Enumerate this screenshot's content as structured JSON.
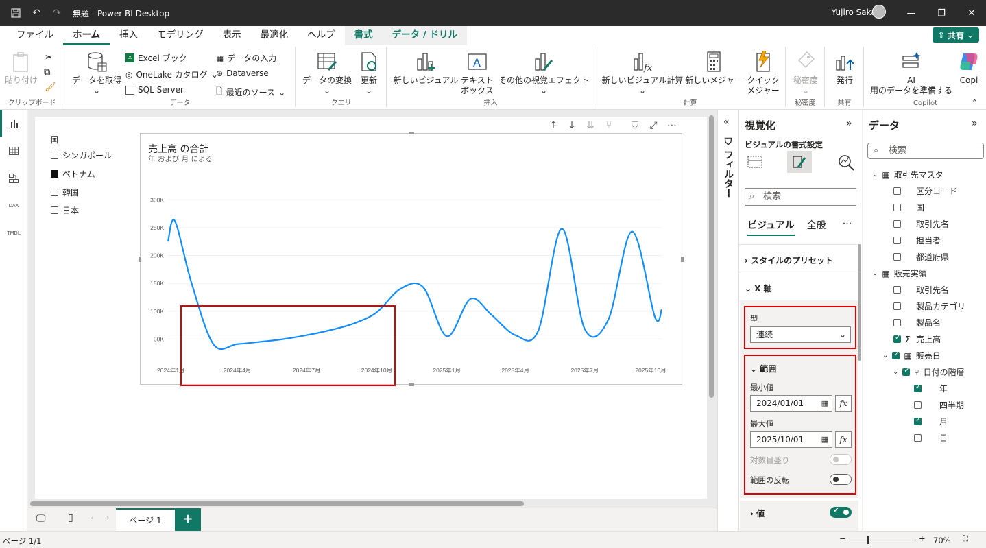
{
  "titlebar": {
    "title": "無題 - Power BI Desktop",
    "user": "Yujiro Sakaki"
  },
  "tabs": [
    "ファイル",
    "ホーム",
    "挿入",
    "モデリング",
    "表示",
    "最適化",
    "ヘルプ",
    "書式",
    "データ / ドリル"
  ],
  "share_label": "共有",
  "ribbon": {
    "clipboard": {
      "paste": "貼り付け",
      "group": "クリップボード"
    },
    "data": {
      "get_data": "データを取得",
      "excel": "Excel ブック",
      "onelake": "OneLake カタログ",
      "sql": "SQL Server",
      "enter": "データの入力",
      "dataverse": "Dataverse",
      "recent": "最近のソース",
      "group": "データ"
    },
    "query": {
      "transform": "データの変換",
      "refresh": "更新",
      "group": "クエリ"
    },
    "insert": {
      "new_visual": "新しいビジュアル",
      "textbox_1": "テキスト",
      "textbox_2": "ボックス",
      "more_visuals": "その他の視覚エフェクト",
      "group": "挿入"
    },
    "calc": {
      "visual_calc": "新しいビジュアル計算",
      "new_measure": "新しいメジャー",
      "quick_1": "クイック",
      "quick_2": "メジャー",
      "group": "計算"
    },
    "sensitivity": {
      "label": "秘密度",
      "group": "秘密度"
    },
    "share": {
      "publish": "発行",
      "group": "共有"
    },
    "copilot": {
      "ai_1": "AI",
      "ai_2": "用のデータを準備する",
      "copilot": "Copi",
      "group": "Copilot"
    }
  },
  "slicer": {
    "title": "国",
    "items": [
      "シンガポール",
      "ベトナム",
      "韓国",
      "日本"
    ],
    "selected_index": 1
  },
  "visual": {
    "title": "売上高 の合計",
    "subtitle": "年 および 月 による"
  },
  "chart_data": {
    "type": "line",
    "title": "売上高 の合計",
    "subtitle": "年 および 月 による",
    "x_ticks": [
      "2024年1月",
      "2024年4月",
      "2024年7月",
      "2024年10月",
      "2025年1月",
      "2025年4月",
      "2025年7月",
      "2025年10月"
    ],
    "y_ticks": [
      "300K",
      "250K",
      "200K",
      "150K",
      "100K",
      "50K"
    ],
    "ylim": [
      0,
      320000
    ],
    "series": [
      {
        "color": "#118DFF",
        "points": [
          [
            "2024-01-01",
            225000
          ],
          [
            "2024-01-10",
            262000
          ],
          [
            "2024-02-01",
            150000
          ],
          [
            "2024-03-01",
            40000
          ],
          [
            "2024-04-01",
            41000
          ],
          [
            "2024-05-01",
            45000
          ],
          [
            "2024-06-01",
            50000
          ],
          [
            "2024-07-01",
            57000
          ],
          [
            "2024-08-01",
            66000
          ],
          [
            "2024-09-01",
            78000
          ],
          [
            "2024-10-01",
            98000
          ],
          [
            "2024-11-01",
            140000
          ],
          [
            "2024-12-01",
            143000
          ],
          [
            "2025-01-01",
            55000
          ],
          [
            "2025-02-01",
            122000
          ],
          [
            "2025-03-01",
            93000
          ],
          [
            "2025-04-01",
            57000
          ],
          [
            "2025-05-01",
            65000
          ],
          [
            "2025-06-01",
            248000
          ],
          [
            "2025-07-01",
            68000
          ],
          [
            "2025-08-01",
            85000
          ],
          [
            "2025-09-01",
            243000
          ],
          [
            "2025-10-01",
            90000
          ],
          [
            "2025-10-10",
            103000
          ]
        ]
      }
    ],
    "x_range": [
      "2024-01-01",
      "2025-10-10"
    ],
    "grid": true
  },
  "filter_pane": {
    "label": "フィルター"
  },
  "viz_pane": {
    "title": "視覚化",
    "subtitle": "ビジュアルの書式設定",
    "search_placeholder": "検索",
    "tab_visual": "ビジュアル",
    "tab_general": "全般",
    "style_presets": "スタイルのプリセット",
    "x_axis": "X 軸",
    "type_label": "型",
    "type_value": "連続",
    "range": "範囲",
    "min_label": "最小値",
    "min_value": "2024/01/01",
    "max_label": "最大値",
    "max_value": "2025/10/01",
    "log_scale": "対数目盛り",
    "invert_range": "範囲の反転",
    "values": "値"
  },
  "data_pane": {
    "title": "データ",
    "search_placeholder": "検索",
    "tables": [
      {
        "name": "取引先マスタ",
        "fields": [
          {
            "name": "区分コード",
            "checked": false
          },
          {
            "name": "国",
            "checked": false
          },
          {
            "name": "取引先名",
            "checked": false
          },
          {
            "name": "担当者",
            "checked": false
          },
          {
            "name": "都道府県",
            "checked": false
          }
        ]
      },
      {
        "name": "販売実績",
        "fields": [
          {
            "name": "取引先名",
            "checked": false
          },
          {
            "name": "製品カテゴリ",
            "checked": false
          },
          {
            "name": "製品名",
            "checked": false
          },
          {
            "name": "売上高",
            "checked": true
          }
        ]
      }
    ],
    "date_field": "販売日",
    "hierarchy": "日付の階層",
    "levels": [
      {
        "name": "年",
        "checked": true
      },
      {
        "name": "四半期",
        "checked": false
      },
      {
        "name": "月",
        "checked": true
      },
      {
        "name": "日",
        "checked": false
      }
    ]
  },
  "pagebar": {
    "page_tab": "ページ 1"
  },
  "status": {
    "page": "ページ 1/1",
    "zoom": "70%"
  }
}
